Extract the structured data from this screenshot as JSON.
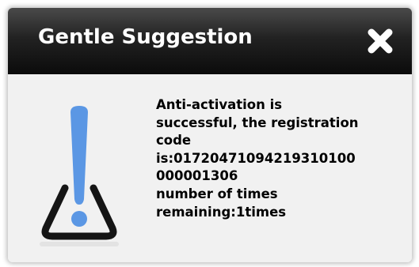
{
  "dialog": {
    "title": "Gentle Suggestion",
    "close_icon": "close-x-icon",
    "warning_icon": "warning-exclamation-icon",
    "message_lines": [
      "Anti-activation is",
      "successful, the registration",
      "code",
      "is:01720471094219310100",
      "000001306",
      "number of times",
      "remaining:1times"
    ]
  },
  "colors": {
    "titlebar": "#1a1a1a",
    "accent_blue": "#5b97e4",
    "body_bg": "#f1f1f1"
  }
}
